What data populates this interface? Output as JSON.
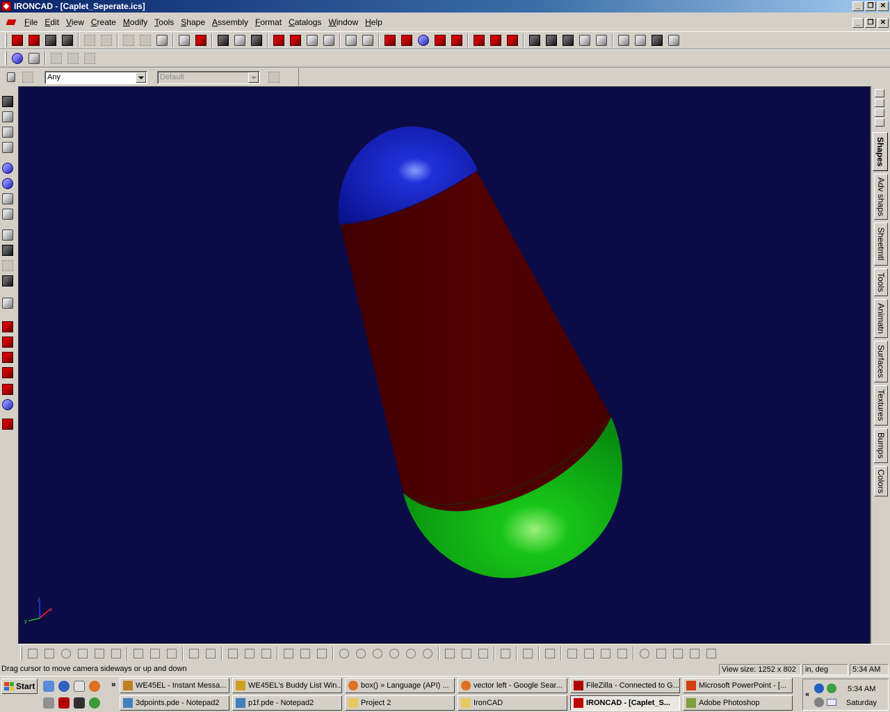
{
  "window": {
    "title": "IRONCAD - [Caplet_Seperate.ics]"
  },
  "window_buttons": {
    "minimize": "_",
    "restore": "❐",
    "close": "✕"
  },
  "menu": [
    {
      "label": "File"
    },
    {
      "label": "Edit"
    },
    {
      "label": "View"
    },
    {
      "label": "Create"
    },
    {
      "label": "Modify"
    },
    {
      "label": "Tools"
    },
    {
      "label": "Shape"
    },
    {
      "label": "Assembly"
    },
    {
      "label": "Format"
    },
    {
      "label": "Catalogs"
    },
    {
      "label": "Window"
    },
    {
      "label": "Help"
    }
  ],
  "selection_bar": {
    "filter_value": "Any",
    "style_value": "Default"
  },
  "viewport": {
    "background": "#0b0b45",
    "object": {
      "top_cap_color": "#0a14b4",
      "body_color": "#4a0000",
      "bottom_cap_color": "#0aa814"
    },
    "triad": {
      "x": "x",
      "y": "y",
      "z": "z"
    }
  },
  "catalog_tabs": [
    {
      "label": "Shapes",
      "active": true
    },
    {
      "label": "Adv shaps"
    },
    {
      "label": "Sheetmtl"
    },
    {
      "label": "Tools"
    },
    {
      "label": "Animatn"
    },
    {
      "label": "Surfaces"
    },
    {
      "label": "Textures"
    },
    {
      "label": "Bumps"
    },
    {
      "label": "Colors"
    }
  ],
  "status": {
    "hint": "Drag cursor to move camera sideways or up and down",
    "view_size": "View size: 1252 x  802",
    "units": "in, deg",
    "time": "5:34 AM"
  },
  "taskbar": {
    "start": "Start",
    "chevron": "»",
    "tasks_row1": [
      {
        "label": "WE45EL - Instant Messa..."
      },
      {
        "label": "WE45EL's Buddy List Win..."
      },
      {
        "label": "box() » Language (API) ..."
      },
      {
        "label": "vector left - Google Sear..."
      },
      {
        "label": "FileZilla - Connected to G..."
      },
      {
        "label": "Microsoft PowerPoint - [..."
      }
    ],
    "tasks_row2": [
      {
        "label": "3dpoints.pde - Notepad2"
      },
      {
        "label": "p1f.pde - Notepad2"
      },
      {
        "label": "Project 2"
      },
      {
        "label": "IronCAD"
      },
      {
        "label": "IRONCAD - [Caplet_S...",
        "active": true
      },
      {
        "label": "Adobe Photoshop"
      }
    ],
    "tray": {
      "chevron": "«",
      "time": "5:34 AM",
      "day": "Saturday"
    }
  }
}
